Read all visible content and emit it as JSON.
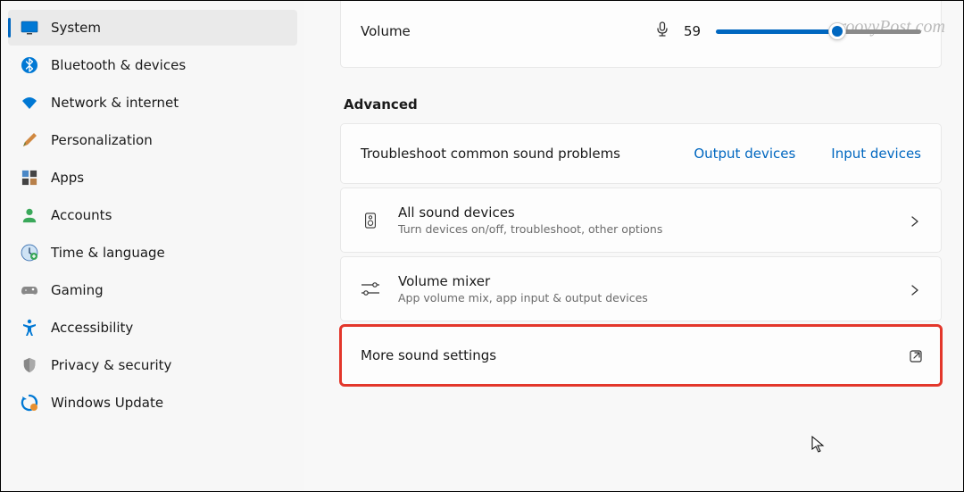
{
  "watermark": "groovyPost.com",
  "sidebar": {
    "items": [
      {
        "label": "System",
        "icon": "system",
        "selected": true
      },
      {
        "label": "Bluetooth & devices",
        "icon": "bluetooth",
        "selected": false
      },
      {
        "label": "Network & internet",
        "icon": "wifi",
        "selected": false
      },
      {
        "label": "Personalization",
        "icon": "brush",
        "selected": false
      },
      {
        "label": "Apps",
        "icon": "apps",
        "selected": false
      },
      {
        "label": "Accounts",
        "icon": "person",
        "selected": false
      },
      {
        "label": "Time & language",
        "icon": "clock",
        "selected": false
      },
      {
        "label": "Gaming",
        "icon": "gamepad",
        "selected": false
      },
      {
        "label": "Accessibility",
        "icon": "accessibility",
        "selected": false
      },
      {
        "label": "Privacy & security",
        "icon": "shield",
        "selected": false
      },
      {
        "label": "Windows Update",
        "icon": "update",
        "selected": false
      }
    ]
  },
  "volume": {
    "label": "Volume",
    "value": 59
  },
  "advanced": {
    "title": "Advanced",
    "troubleshoot": {
      "label": "Troubleshoot common sound problems",
      "output_link": "Output devices",
      "input_link": "Input devices"
    },
    "all_devices": {
      "title": "All sound devices",
      "subtitle": "Turn devices on/off, troubleshoot, other options"
    },
    "mixer": {
      "title": "Volume mixer",
      "subtitle": "App volume mix, app input & output devices"
    },
    "more": {
      "title": "More sound settings"
    }
  }
}
